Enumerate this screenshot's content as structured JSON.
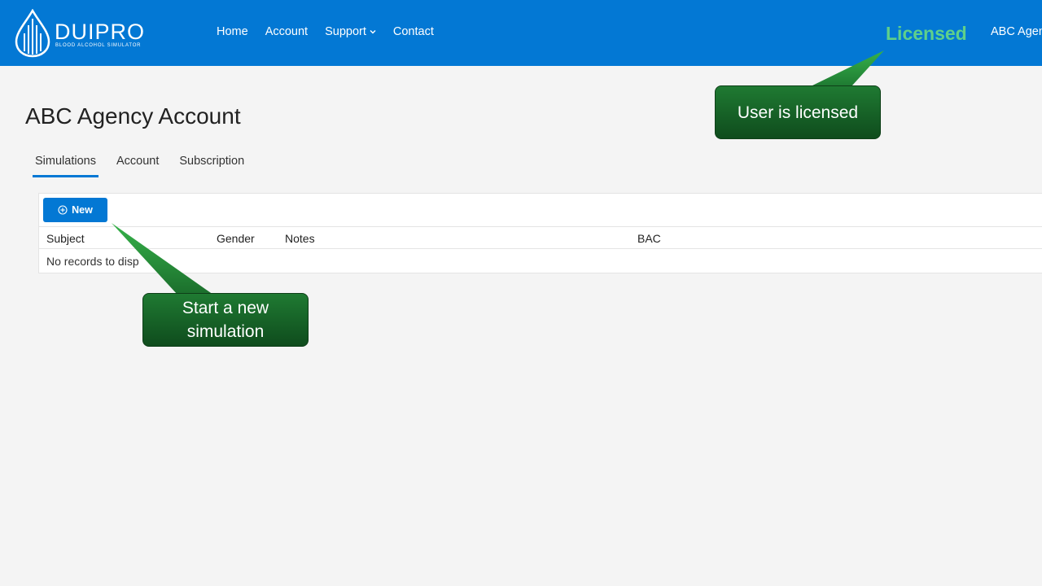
{
  "header": {
    "logo_word": "DUIPRO",
    "logo_tagline": "BLOOD ALCOHOL SIMULATOR",
    "nav": [
      {
        "label": "Home"
      },
      {
        "label": "Account"
      },
      {
        "label": "Support"
      },
      {
        "label": "Contact"
      }
    ],
    "license_status": "Licensed",
    "user_name": "ABC Agen"
  },
  "page": {
    "title": "ABC Agency Account",
    "tabs": [
      {
        "label": "Simulations",
        "active": true
      },
      {
        "label": "Account",
        "active": false
      },
      {
        "label": "Subscription",
        "active": false
      }
    ]
  },
  "grid": {
    "new_button_label": "New",
    "columns": [
      "Subject",
      "Gender",
      "Notes",
      "BAC"
    ],
    "empty_message": "No records to disp"
  },
  "callouts": {
    "licensed": "User is licensed",
    "new_simulation": "Start a new simulation"
  },
  "colors": {
    "header_bg": "#0378d4",
    "licensed_text": "#5fd08a",
    "callout_bg": "#1a6a2b",
    "page_bg": "#f4f4f4"
  }
}
